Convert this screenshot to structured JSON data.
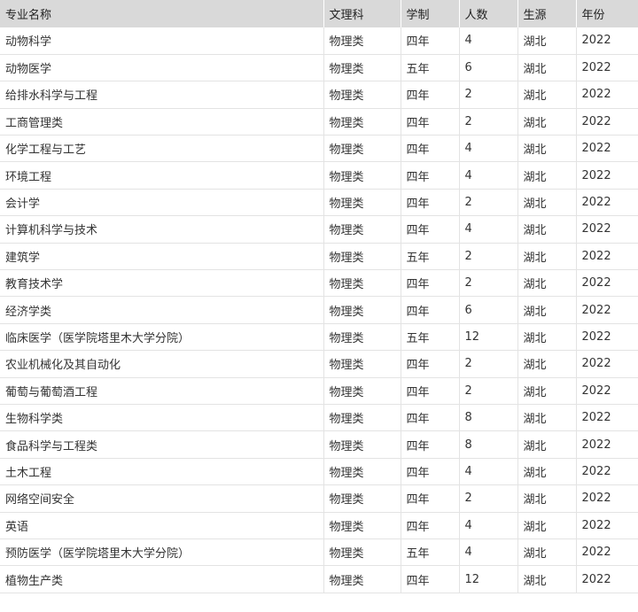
{
  "table": {
    "headers": [
      "专业名称",
      "文理科",
      "学制",
      "人数",
      "生源",
      "年份"
    ],
    "rows": [
      [
        "动物科学",
        "物理类",
        "四年",
        "4",
        "湖北",
        "2022"
      ],
      [
        "动物医学",
        "物理类",
        "五年",
        "6",
        "湖北",
        "2022"
      ],
      [
        "给排水科学与工程",
        "物理类",
        "四年",
        "2",
        "湖北",
        "2022"
      ],
      [
        "工商管理类",
        "物理类",
        "四年",
        "2",
        "湖北",
        "2022"
      ],
      [
        "化学工程与工艺",
        "物理类",
        "四年",
        "4",
        "湖北",
        "2022"
      ],
      [
        "环境工程",
        "物理类",
        "四年",
        "4",
        "湖北",
        "2022"
      ],
      [
        "会计学",
        "物理类",
        "四年",
        "2",
        "湖北",
        "2022"
      ],
      [
        "计算机科学与技术",
        "物理类",
        "四年",
        "4",
        "湖北",
        "2022"
      ],
      [
        "建筑学",
        "物理类",
        "五年",
        "2",
        "湖北",
        "2022"
      ],
      [
        "教育技术学",
        "物理类",
        "四年",
        "2",
        "湖北",
        "2022"
      ],
      [
        "经济学类",
        "物理类",
        "四年",
        "6",
        "湖北",
        "2022"
      ],
      [
        "临床医学（医学院塔里木大学分院）",
        "物理类",
        "五年",
        "12",
        "湖北",
        "2022"
      ],
      [
        "农业机械化及其自动化",
        "物理类",
        "四年",
        "2",
        "湖北",
        "2022"
      ],
      [
        "葡萄与葡萄酒工程",
        "物理类",
        "四年",
        "2",
        "湖北",
        "2022"
      ],
      [
        "生物科学类",
        "物理类",
        "四年",
        "8",
        "湖北",
        "2022"
      ],
      [
        "食品科学与工程类",
        "物理类",
        "四年",
        "8",
        "湖北",
        "2022"
      ],
      [
        "土木工程",
        "物理类",
        "四年",
        "4",
        "湖北",
        "2022"
      ],
      [
        "网络空间安全",
        "物理类",
        "四年",
        "2",
        "湖北",
        "2022"
      ],
      [
        "英语",
        "物理类",
        "四年",
        "4",
        "湖北",
        "2022"
      ],
      [
        "预防医学（医学院塔里木大学分院）",
        "物理类",
        "五年",
        "4",
        "湖北",
        "2022"
      ],
      [
        "植物生产类",
        "物理类",
        "四年",
        "12",
        "湖北",
        "2022"
      ]
    ]
  }
}
